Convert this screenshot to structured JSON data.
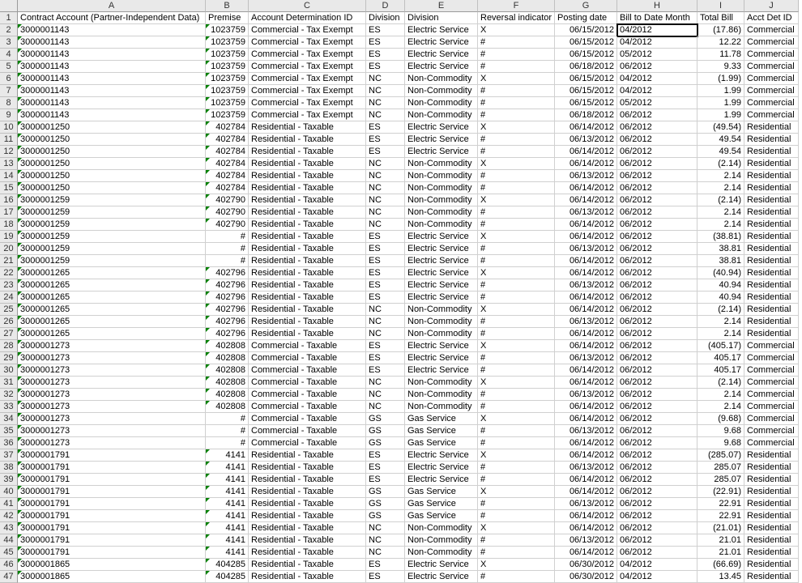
{
  "columns": [
    "A",
    "B",
    "C",
    "D",
    "E",
    "F",
    "G",
    "H",
    "I",
    "J"
  ],
  "headers": {
    "A": "Contract Account (Partner-Independent Data)",
    "B": "Premise",
    "C": "Account Determination ID",
    "D": "Division",
    "E": "Division",
    "F": "Reversal indicator",
    "G": "Posting date",
    "H": "Bill to Date Month",
    "I": "Total Bill",
    "J": "Acct Det ID"
  },
  "selected_cell": "H2",
  "green_triangle_cells": [
    "A2",
    "A3",
    "A4",
    "A5",
    "A6",
    "A7",
    "A8",
    "A9",
    "A10",
    "A11",
    "A12",
    "A13",
    "A14",
    "A15",
    "A16",
    "A17",
    "A18",
    "A19",
    "A20",
    "A21",
    "A22",
    "A23",
    "A24",
    "A25",
    "A26",
    "A27",
    "A28",
    "A29",
    "A30",
    "A31",
    "A32",
    "A33",
    "A34",
    "A35",
    "A36",
    "A37",
    "A38",
    "A39",
    "A40",
    "A41",
    "A42",
    "A43",
    "A44",
    "A45",
    "A46",
    "A47",
    "B2",
    "B3",
    "B4",
    "B5",
    "B6",
    "B7",
    "B8",
    "B9",
    "B10",
    "B11",
    "B12",
    "B13",
    "B14",
    "B15",
    "B16",
    "B17",
    "B18",
    "B22",
    "B23",
    "B24",
    "B25",
    "B26",
    "B27",
    "B28",
    "B29",
    "B30",
    "B31",
    "B32",
    "B33",
    "B37",
    "B38",
    "B39",
    "B40",
    "B41",
    "B42",
    "B43",
    "B44",
    "B45",
    "B46",
    "B47"
  ],
  "chart_data": {
    "type": "table",
    "rows": [
      {
        "r": 2,
        "A": "3000001143",
        "B": "1023759",
        "C": "Commercial - Tax Exempt",
        "D": "ES",
        "E": "Electric Service",
        "F": "X",
        "G": "06/15/2012",
        "H": "04/2012",
        "I": "(17.86)",
        "J": "Commercial"
      },
      {
        "r": 3,
        "A": "3000001143",
        "B": "1023759",
        "C": "Commercial - Tax Exempt",
        "D": "ES",
        "E": "Electric Service",
        "F": "#",
        "G": "06/15/2012",
        "H": "04/2012",
        "I": "12.22",
        "J": "Commercial"
      },
      {
        "r": 4,
        "A": "3000001143",
        "B": "1023759",
        "C": "Commercial - Tax Exempt",
        "D": "ES",
        "E": "Electric Service",
        "F": "#",
        "G": "06/15/2012",
        "H": "05/2012",
        "I": "11.78",
        "J": "Commercial"
      },
      {
        "r": 5,
        "A": "3000001143",
        "B": "1023759",
        "C": "Commercial - Tax Exempt",
        "D": "ES",
        "E": "Electric Service",
        "F": "#",
        "G": "06/18/2012",
        "H": "06/2012",
        "I": "9.33",
        "J": "Commercial"
      },
      {
        "r": 6,
        "A": "3000001143",
        "B": "1023759",
        "C": "Commercial - Tax Exempt",
        "D": "NC",
        "E": "Non-Commodity",
        "F": "X",
        "G": "06/15/2012",
        "H": "04/2012",
        "I": "(1.99)",
        "J": "Commercial"
      },
      {
        "r": 7,
        "A": "3000001143",
        "B": "1023759",
        "C": "Commercial - Tax Exempt",
        "D": "NC",
        "E": "Non-Commodity",
        "F": "#",
        "G": "06/15/2012",
        "H": "04/2012",
        "I": "1.99",
        "J": "Commercial"
      },
      {
        "r": 8,
        "A": "3000001143",
        "B": "1023759",
        "C": "Commercial - Tax Exempt",
        "D": "NC",
        "E": "Non-Commodity",
        "F": "#",
        "G": "06/15/2012",
        "H": "05/2012",
        "I": "1.99",
        "J": "Commercial"
      },
      {
        "r": 9,
        "A": "3000001143",
        "B": "1023759",
        "C": "Commercial - Tax Exempt",
        "D": "NC",
        "E": "Non-Commodity",
        "F": "#",
        "G": "06/18/2012",
        "H": "06/2012",
        "I": "1.99",
        "J": "Commercial"
      },
      {
        "r": 10,
        "A": "3000001250",
        "B": "402784",
        "C": "Residential - Taxable",
        "D": "ES",
        "E": "Electric Service",
        "F": "X",
        "G": "06/14/2012",
        "H": "06/2012",
        "I": "(49.54)",
        "J": "Residential"
      },
      {
        "r": 11,
        "A": "3000001250",
        "B": "402784",
        "C": "Residential - Taxable",
        "D": "ES",
        "E": "Electric Service",
        "F": "#",
        "G": "06/13/2012",
        "H": "06/2012",
        "I": "49.54",
        "J": "Residential"
      },
      {
        "r": 12,
        "A": "3000001250",
        "B": "402784",
        "C": "Residential - Taxable",
        "D": "ES",
        "E": "Electric Service",
        "F": "#",
        "G": "06/14/2012",
        "H": "06/2012",
        "I": "49.54",
        "J": "Residential"
      },
      {
        "r": 13,
        "A": "3000001250",
        "B": "402784",
        "C": "Residential - Taxable",
        "D": "NC",
        "E": "Non-Commodity",
        "F": "X",
        "G": "06/14/2012",
        "H": "06/2012",
        "I": "(2.14)",
        "J": "Residential"
      },
      {
        "r": 14,
        "A": "3000001250",
        "B": "402784",
        "C": "Residential - Taxable",
        "D": "NC",
        "E": "Non-Commodity",
        "F": "#",
        "G": "06/13/2012",
        "H": "06/2012",
        "I": "2.14",
        "J": "Residential"
      },
      {
        "r": 15,
        "A": "3000001250",
        "B": "402784",
        "C": "Residential - Taxable",
        "D": "NC",
        "E": "Non-Commodity",
        "F": "#",
        "G": "06/14/2012",
        "H": "06/2012",
        "I": "2.14",
        "J": "Residential"
      },
      {
        "r": 16,
        "A": "3000001259",
        "B": "402790",
        "C": "Residential - Taxable",
        "D": "NC",
        "E": "Non-Commodity",
        "F": "X",
        "G": "06/14/2012",
        "H": "06/2012",
        "I": "(2.14)",
        "J": "Residential"
      },
      {
        "r": 17,
        "A": "3000001259",
        "B": "402790",
        "C": "Residential - Taxable",
        "D": "NC",
        "E": "Non-Commodity",
        "F": "#",
        "G": "06/13/2012",
        "H": "06/2012",
        "I": "2.14",
        "J": "Residential"
      },
      {
        "r": 18,
        "A": "3000001259",
        "B": "402790",
        "C": "Residential - Taxable",
        "D": "NC",
        "E": "Non-Commodity",
        "F": "#",
        "G": "06/14/2012",
        "H": "06/2012",
        "I": "2.14",
        "J": "Residential"
      },
      {
        "r": 19,
        "A": "3000001259",
        "B": "#",
        "C": "Residential - Taxable",
        "D": "ES",
        "E": "Electric Service",
        "F": "X",
        "G": "06/14/2012",
        "H": "06/2012",
        "I": "(38.81)",
        "J": "Residential"
      },
      {
        "r": 20,
        "A": "3000001259",
        "B": "#",
        "C": "Residential - Taxable",
        "D": "ES",
        "E": "Electric Service",
        "F": "#",
        "G": "06/13/2012",
        "H": "06/2012",
        "I": "38.81",
        "J": "Residential"
      },
      {
        "r": 21,
        "A": "3000001259",
        "B": "#",
        "C": "Residential - Taxable",
        "D": "ES",
        "E": "Electric Service",
        "F": "#",
        "G": "06/14/2012",
        "H": "06/2012",
        "I": "38.81",
        "J": "Residential"
      },
      {
        "r": 22,
        "A": "3000001265",
        "B": "402796",
        "C": "Residential - Taxable",
        "D": "ES",
        "E": "Electric Service",
        "F": "X",
        "G": "06/14/2012",
        "H": "06/2012",
        "I": "(40.94)",
        "J": "Residential"
      },
      {
        "r": 23,
        "A": "3000001265",
        "B": "402796",
        "C": "Residential - Taxable",
        "D": "ES",
        "E": "Electric Service",
        "F": "#",
        "G": "06/13/2012",
        "H": "06/2012",
        "I": "40.94",
        "J": "Residential"
      },
      {
        "r": 24,
        "A": "3000001265",
        "B": "402796",
        "C": "Residential - Taxable",
        "D": "ES",
        "E": "Electric Service",
        "F": "#",
        "G": "06/14/2012",
        "H": "06/2012",
        "I": "40.94",
        "J": "Residential"
      },
      {
        "r": 25,
        "A": "3000001265",
        "B": "402796",
        "C": "Residential - Taxable",
        "D": "NC",
        "E": "Non-Commodity",
        "F": "X",
        "G": "06/14/2012",
        "H": "06/2012",
        "I": "(2.14)",
        "J": "Residential"
      },
      {
        "r": 26,
        "A": "3000001265",
        "B": "402796",
        "C": "Residential - Taxable",
        "D": "NC",
        "E": "Non-Commodity",
        "F": "#",
        "G": "06/13/2012",
        "H": "06/2012",
        "I": "2.14",
        "J": "Residential"
      },
      {
        "r": 27,
        "A": "3000001265",
        "B": "402796",
        "C": "Residential - Taxable",
        "D": "NC",
        "E": "Non-Commodity",
        "F": "#",
        "G": "06/14/2012",
        "H": "06/2012",
        "I": "2.14",
        "J": "Residential"
      },
      {
        "r": 28,
        "A": "3000001273",
        "B": "402808",
        "C": "Commercial - Taxable",
        "D": "ES",
        "E": "Electric Service",
        "F": "X",
        "G": "06/14/2012",
        "H": "06/2012",
        "I": "(405.17)",
        "J": "Commercial"
      },
      {
        "r": 29,
        "A": "3000001273",
        "B": "402808",
        "C": "Commercial - Taxable",
        "D": "ES",
        "E": "Electric Service",
        "F": "#",
        "G": "06/13/2012",
        "H": "06/2012",
        "I": "405.17",
        "J": "Commercial"
      },
      {
        "r": 30,
        "A": "3000001273",
        "B": "402808",
        "C": "Commercial - Taxable",
        "D": "ES",
        "E": "Electric Service",
        "F": "#",
        "G": "06/14/2012",
        "H": "06/2012",
        "I": "405.17",
        "J": "Commercial"
      },
      {
        "r": 31,
        "A": "3000001273",
        "B": "402808",
        "C": "Commercial - Taxable",
        "D": "NC",
        "E": "Non-Commodity",
        "F": "X",
        "G": "06/14/2012",
        "H": "06/2012",
        "I": "(2.14)",
        "J": "Commercial"
      },
      {
        "r": 32,
        "A": "3000001273",
        "B": "402808",
        "C": "Commercial - Taxable",
        "D": "NC",
        "E": "Non-Commodity",
        "F": "#",
        "G": "06/13/2012",
        "H": "06/2012",
        "I": "2.14",
        "J": "Commercial"
      },
      {
        "r": 33,
        "A": "3000001273",
        "B": "402808",
        "C": "Commercial - Taxable",
        "D": "NC",
        "E": "Non-Commodity",
        "F": "#",
        "G": "06/14/2012",
        "H": "06/2012",
        "I": "2.14",
        "J": "Commercial"
      },
      {
        "r": 34,
        "A": "3000001273",
        "B": "#",
        "C": "Commercial - Taxable",
        "D": "GS",
        "E": "Gas Service",
        "F": "X",
        "G": "06/14/2012",
        "H": "06/2012",
        "I": "(9.68)",
        "J": "Commercial"
      },
      {
        "r": 35,
        "A": "3000001273",
        "B": "#",
        "C": "Commercial - Taxable",
        "D": "GS",
        "E": "Gas Service",
        "F": "#",
        "G": "06/13/2012",
        "H": "06/2012",
        "I": "9.68",
        "J": "Commercial"
      },
      {
        "r": 36,
        "A": "3000001273",
        "B": "#",
        "C": "Commercial - Taxable",
        "D": "GS",
        "E": "Gas Service",
        "F": "#",
        "G": "06/14/2012",
        "H": "06/2012",
        "I": "9.68",
        "J": "Commercial"
      },
      {
        "r": 37,
        "A": "3000001791",
        "B": "4141",
        "C": "Residential - Taxable",
        "D": "ES",
        "E": "Electric Service",
        "F": "X",
        "G": "06/14/2012",
        "H": "06/2012",
        "I": "(285.07)",
        "J": "Residential"
      },
      {
        "r": 38,
        "A": "3000001791",
        "B": "4141",
        "C": "Residential - Taxable",
        "D": "ES",
        "E": "Electric Service",
        "F": "#",
        "G": "06/13/2012",
        "H": "06/2012",
        "I": "285.07",
        "J": "Residential"
      },
      {
        "r": 39,
        "A": "3000001791",
        "B": "4141",
        "C": "Residential - Taxable",
        "D": "ES",
        "E": "Electric Service",
        "F": "#",
        "G": "06/14/2012",
        "H": "06/2012",
        "I": "285.07",
        "J": "Residential"
      },
      {
        "r": 40,
        "A": "3000001791",
        "B": "4141",
        "C": "Residential - Taxable",
        "D": "GS",
        "E": "Gas Service",
        "F": "X",
        "G": "06/14/2012",
        "H": "06/2012",
        "I": "(22.91)",
        "J": "Residential"
      },
      {
        "r": 41,
        "A": "3000001791",
        "B": "4141",
        "C": "Residential - Taxable",
        "D": "GS",
        "E": "Gas Service",
        "F": "#",
        "G": "06/13/2012",
        "H": "06/2012",
        "I": "22.91",
        "J": "Residential"
      },
      {
        "r": 42,
        "A": "3000001791",
        "B": "4141",
        "C": "Residential - Taxable",
        "D": "GS",
        "E": "Gas Service",
        "F": "#",
        "G": "06/14/2012",
        "H": "06/2012",
        "I": "22.91",
        "J": "Residential"
      },
      {
        "r": 43,
        "A": "3000001791",
        "B": "4141",
        "C": "Residential - Taxable",
        "D": "NC",
        "E": "Non-Commodity",
        "F": "X",
        "G": "06/14/2012",
        "H": "06/2012",
        "I": "(21.01)",
        "J": "Residential"
      },
      {
        "r": 44,
        "A": "3000001791",
        "B": "4141",
        "C": "Residential - Taxable",
        "D": "NC",
        "E": "Non-Commodity",
        "F": "#",
        "G": "06/13/2012",
        "H": "06/2012",
        "I": "21.01",
        "J": "Residential"
      },
      {
        "r": 45,
        "A": "3000001791",
        "B": "4141",
        "C": "Residential - Taxable",
        "D": "NC",
        "E": "Non-Commodity",
        "F": "#",
        "G": "06/14/2012",
        "H": "06/2012",
        "I": "21.01",
        "J": "Residential"
      },
      {
        "r": 46,
        "A": "3000001865",
        "B": "404285",
        "C": "Residential - Taxable",
        "D": "ES",
        "E": "Electric Service",
        "F": "X",
        "G": "06/30/2012",
        "H": "04/2012",
        "I": "(66.69)",
        "J": "Residential"
      },
      {
        "r": 47,
        "A": "3000001865",
        "B": "404285",
        "C": "Residential - Taxable",
        "D": "ES",
        "E": "Electric Service",
        "F": "#",
        "G": "06/30/2012",
        "H": "04/2012",
        "I": "13.45",
        "J": "Residential"
      }
    ]
  }
}
